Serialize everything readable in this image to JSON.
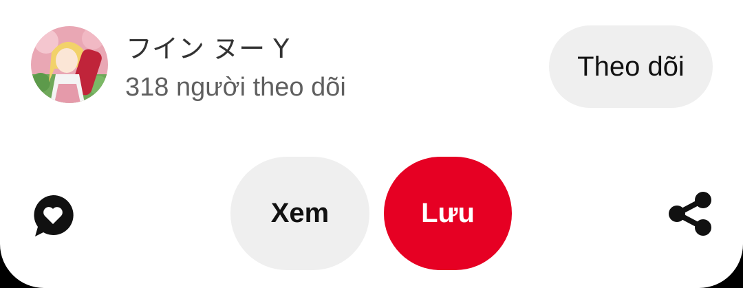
{
  "creator": {
    "name": "フイン ヌー Y",
    "followers": "318 người theo dõi",
    "avatar_icon": "anime-girl-avatar"
  },
  "actions": {
    "follow_label": "Theo dõi",
    "view_label": "Xem",
    "save_label": "Lưu",
    "comment_icon": "comment-heart-icon",
    "share_icon": "share-icon"
  },
  "colors": {
    "accent": "#e60023",
    "button_bg": "#efefef",
    "text_primary": "#111111",
    "text_secondary": "#5f5f5f"
  }
}
